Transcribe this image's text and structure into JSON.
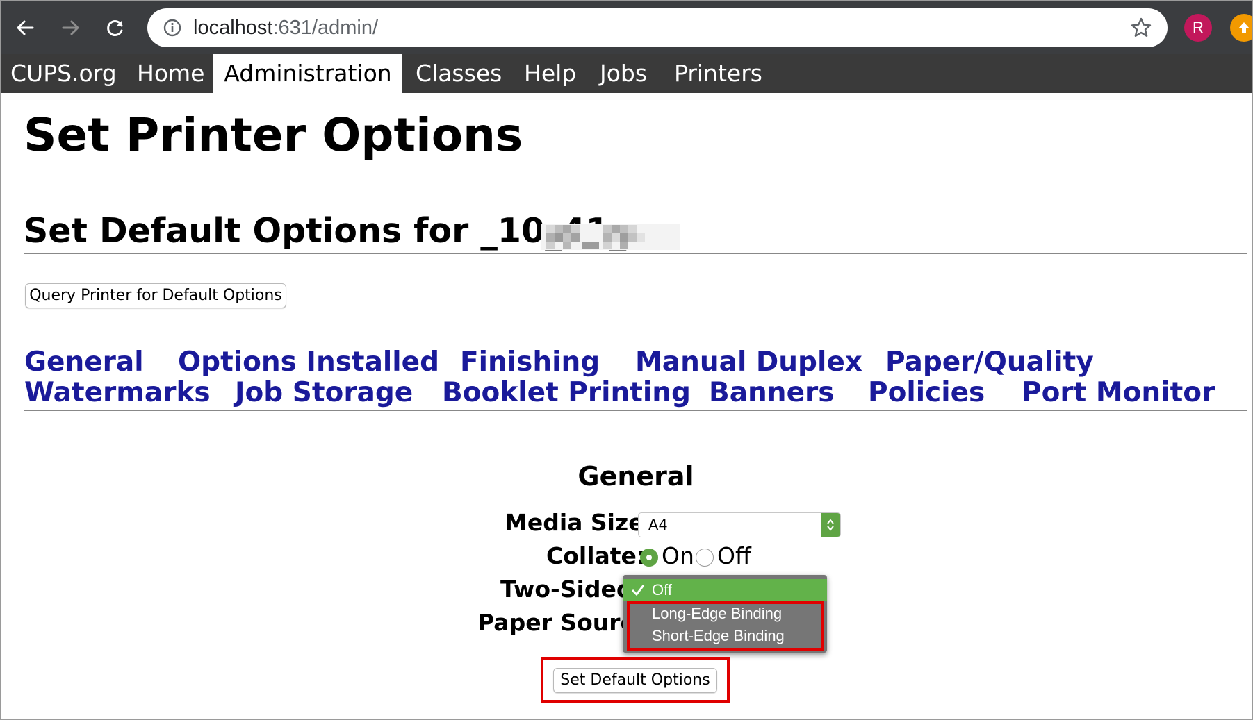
{
  "browser": {
    "url_host": "localhost",
    "url_path": ":631/admin/",
    "avatar_initial": "R",
    "icons": [
      "back-arrow-icon",
      "forward-arrow-icon",
      "reload-icon",
      "info-icon",
      "star-icon",
      "update-arrow-icon"
    ]
  },
  "menubar": {
    "items": [
      "CUPS.org",
      "Home",
      "Administration",
      "Classes",
      "Help",
      "Jobs",
      "Printers"
    ],
    "active": "Administration"
  },
  "page": {
    "title": "Set Printer Options",
    "subtitle": "Set Default Options for _10_41_"
  },
  "query_button": "Query Printer for Default Options",
  "tabs": {
    "row1": [
      "General",
      "Options Installed",
      "Finishing",
      "Manual Duplex",
      "Paper/Quality"
    ],
    "row2": [
      "Watermarks",
      "Job Storage",
      "Booklet Printing",
      "Banners",
      "Policies",
      "Port Monitor"
    ]
  },
  "general": {
    "section_title": "General",
    "media_size_label": "Media Size:",
    "media_size_value": "A4",
    "collate_label": "Collate:",
    "collate_on": "On",
    "collate_off": "Off",
    "collate_selected": "On",
    "two_sided_label": "Two-Sided",
    "paper_source_label": "Paper Source"
  },
  "two_sided_dropdown": {
    "options": [
      "Off",
      "Long-Edge Binding",
      "Short-Edge Binding"
    ],
    "selected": "Off"
  },
  "set_button": "Set Default Options",
  "colors": {
    "menubar_bg": "#3a3a3a",
    "link": "#1a1a9a",
    "accent_green": "#5fa444",
    "highlight_red": "#e00000"
  }
}
